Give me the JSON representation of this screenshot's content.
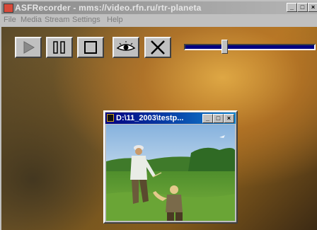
{
  "app": {
    "title": "ASFRecorder - mms://video.rfn.ru/rtr-planeta"
  },
  "window_controls": {
    "minimize": "_",
    "maximize": "□",
    "close": "×"
  },
  "menu": [
    {
      "label": "File"
    },
    {
      "label": "Media"
    },
    {
      "label": "Stream"
    },
    {
      "label": "Settings"
    },
    {
      "label": "Help"
    }
  ],
  "toolbar": {
    "buttons": [
      {
        "icon": "play-icon"
      },
      {
        "icon": "pause-icon"
      },
      {
        "icon": "stop-icon"
      },
      {
        "icon": "eye-icon"
      },
      {
        "icon": "close-x-icon"
      }
    ]
  },
  "slider": {
    "position": 0.3
  },
  "video_window": {
    "title": "D:\\11_2003\\testp..."
  },
  "colors": {
    "titlebar_inactive_start": "#8a8a8a",
    "video_titlebar_start": "#000080",
    "video_titlebar_end": "#1084d0",
    "slider_track": "#000080"
  }
}
